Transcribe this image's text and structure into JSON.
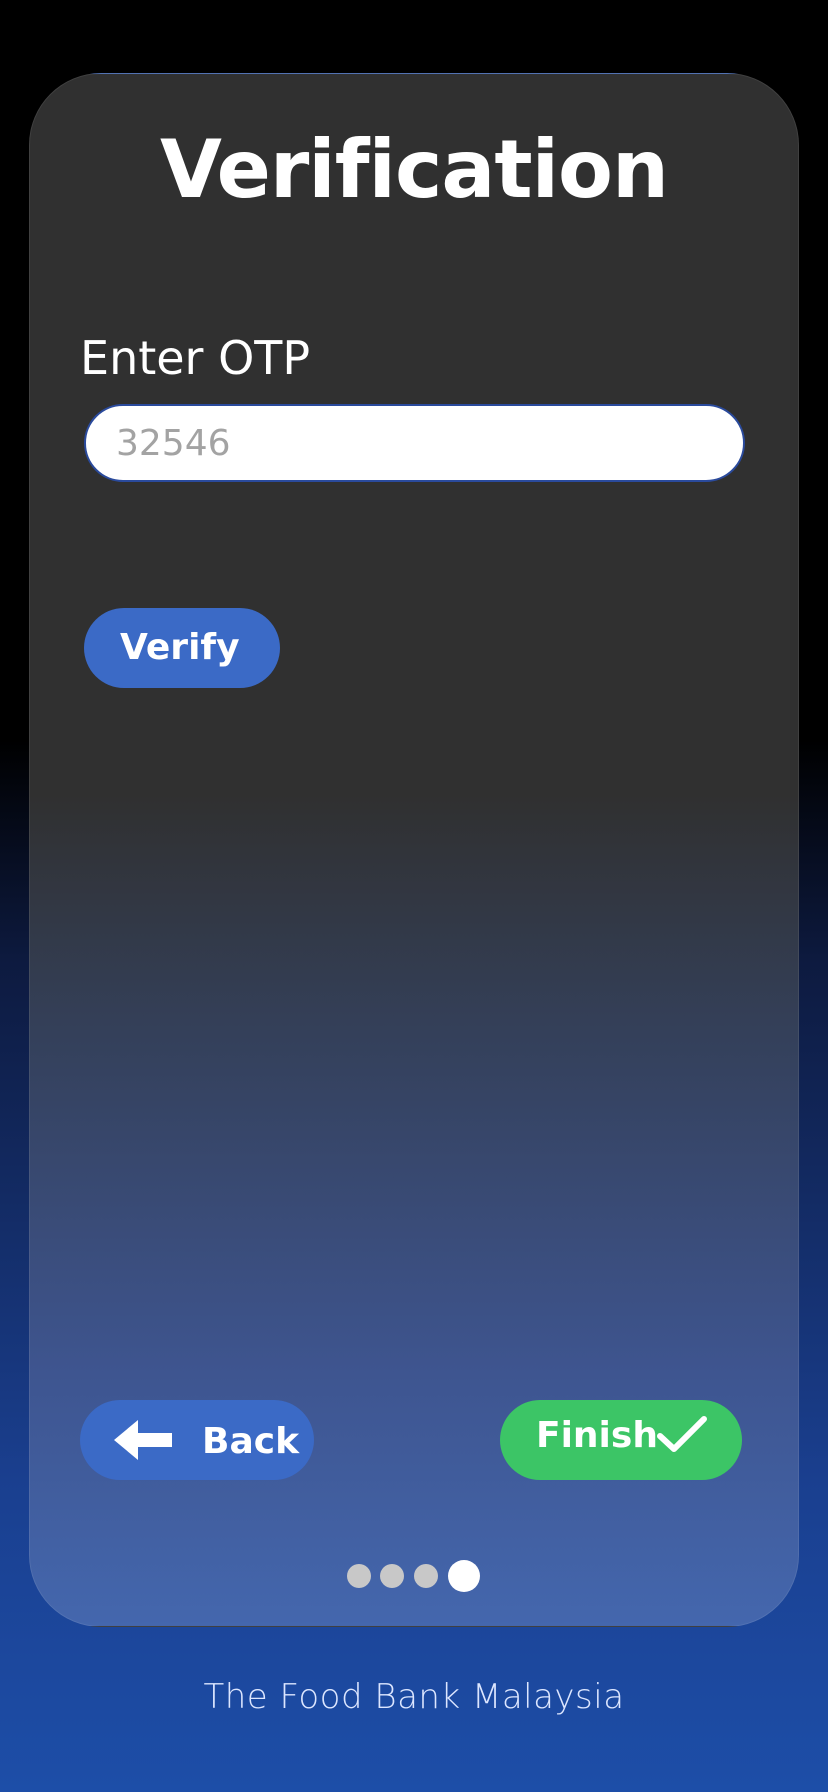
{
  "header": {
    "title": "Verification"
  },
  "form": {
    "otp_label": "Enter OTP",
    "otp_placeholder": "32546",
    "otp_value": "",
    "verify_label": "Verify"
  },
  "navigation": {
    "back_label": "Back",
    "back_icon": "arrow-left-icon",
    "finish_label": "Finish",
    "finish_icon": "check-icon"
  },
  "pager": {
    "total_steps": 4,
    "current_step": 4
  },
  "footer": {
    "text": "The Food Bank Malaysia"
  },
  "colors": {
    "primary_button": "#3b6ac6",
    "finish_button": "#3cc566",
    "card_top": "#303030",
    "card_bottom": "#4467ae",
    "background_bottom": "#1d4ea8"
  }
}
